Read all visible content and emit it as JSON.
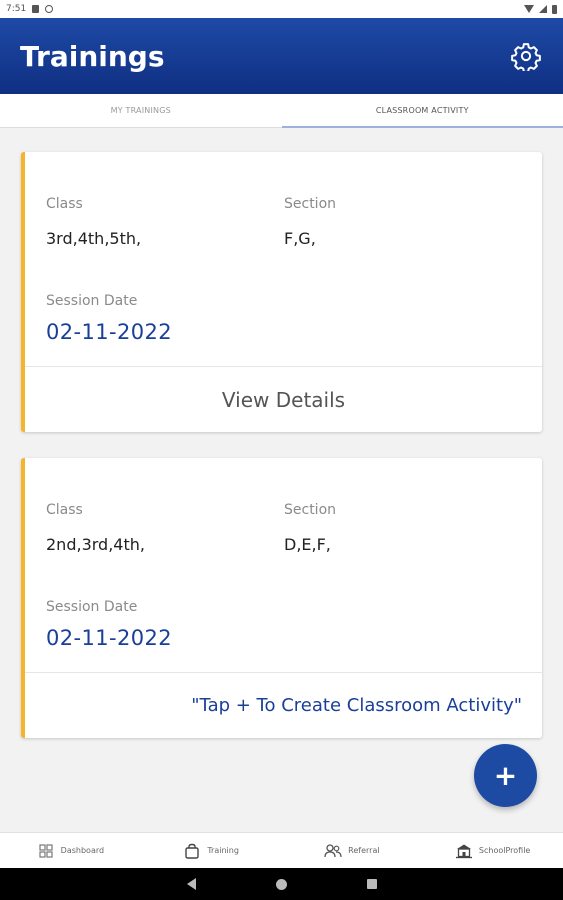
{
  "status_bar": {
    "time": "7:51"
  },
  "app_bar": {
    "title": "Trainings"
  },
  "tabs": [
    {
      "label": "MY TRAININGS",
      "active": false
    },
    {
      "label": "CLASSROOM ACTIVITY",
      "active": true
    }
  ],
  "cards": [
    {
      "class_label": "Class",
      "class_value": "3rd,4th,5th,",
      "section_label": "Section",
      "section_value": "F,G,",
      "date_label": "Session Date",
      "date_value": "02-11-2022",
      "action_label": "View Details"
    },
    {
      "class_label": "Class",
      "class_value": "2nd,3rd,4th,",
      "section_label": "Section",
      "section_value": "D,E,F,",
      "date_label": "Session Date",
      "date_value": "02-11-2022",
      "hint_text": "\"Tap + To Create Classroom Activity\""
    }
  ],
  "fab": {
    "label": "+"
  },
  "bottom_nav": [
    {
      "label": "Dashboard",
      "icon": "grid-icon"
    },
    {
      "label": "Training",
      "icon": "bag-icon"
    },
    {
      "label": "Referral",
      "icon": "people-icon"
    },
    {
      "label": "SchoolProfile",
      "icon": "school-icon"
    }
  ],
  "colors": {
    "app_bar": "#1e4aa6",
    "accent_stripe": "#f5b42a",
    "date_text": "#1a3f99",
    "fab": "#1d4aa3"
  }
}
